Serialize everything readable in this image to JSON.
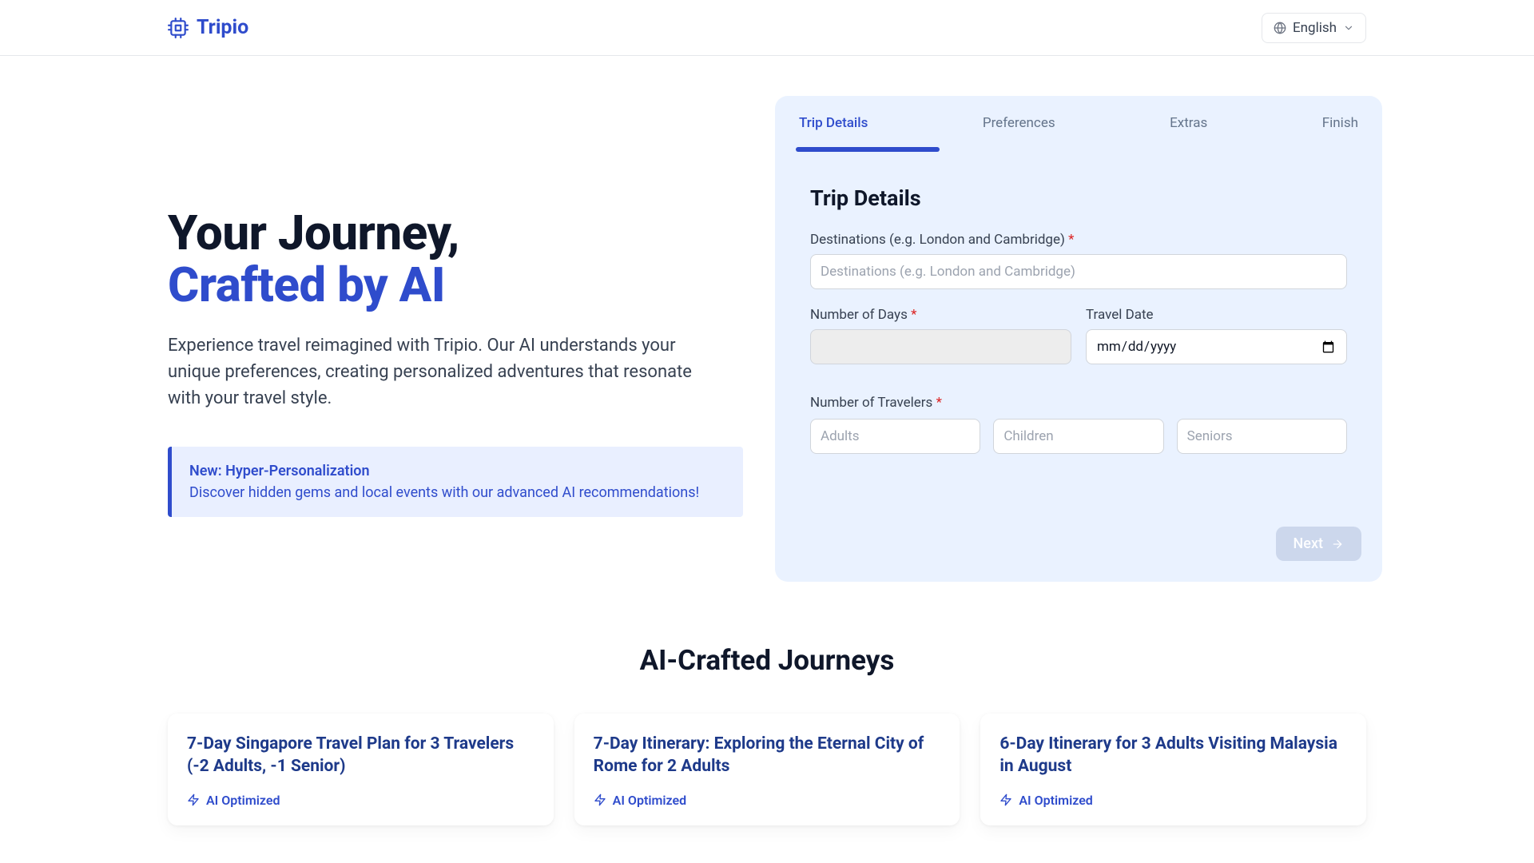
{
  "header": {
    "logo_text": "Tripio",
    "language_label": "English"
  },
  "hero": {
    "headline_line1": "Your Journey,",
    "headline_line2": "Crafted by AI",
    "subtext": "Experience travel reimagined with Tripio. Our AI understands your unique preferences, creating personalized adventures that resonate with your travel style.",
    "callout_title": "New: Hyper-Personalization",
    "callout_body": "Discover hidden gems and local events with our advanced AI recommendations!"
  },
  "form": {
    "steps": [
      "Trip Details",
      "Preferences",
      "Extras",
      "Finish"
    ],
    "active_step_index": 0,
    "section_title": "Trip Details",
    "destinations_label": "Destinations (e.g. London and Cambridge)",
    "destinations_placeholder": "Destinations (e.g. London and Cambridge)",
    "days_label": "Number of Days",
    "travel_date_label": "Travel Date",
    "travel_date_placeholder": "mm/dd/yyyy",
    "travelers_label": "Number of Travelers",
    "adults_placeholder": "Adults",
    "children_placeholder": "Children",
    "seniors_placeholder": "Seniors",
    "next_button": "Next",
    "required_marker": "*"
  },
  "journeys": {
    "title": "AI-Crafted Journeys",
    "ai_badge": "AI Optimized",
    "cards": [
      {
        "title": "7-Day Singapore Travel Plan for 3 Travelers (-2 Adults, -1 Senior)"
      },
      {
        "title": "7-Day Itinerary: Exploring the Eternal City of Rome for 2 Adults"
      },
      {
        "title": "6-Day Itinerary for 3 Adults Visiting Malaysia in August"
      }
    ]
  }
}
